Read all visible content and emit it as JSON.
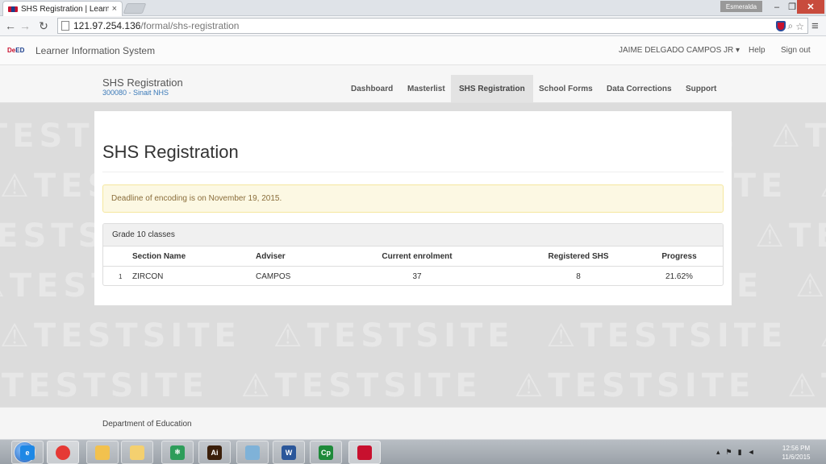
{
  "browser": {
    "tab_title": "SHS Registration | Learner",
    "tab_close": "×",
    "user_badge": "Esmeralda",
    "url_host": "121.97.254.136",
    "url_path": "/formal/shs-registration"
  },
  "header": {
    "logo_a": "De",
    "logo_b": "ED",
    "app_title": "Learner Information System",
    "user_name": "JAIME DELGADO CAMPOS JR",
    "help": "Help",
    "sign_out": "Sign out"
  },
  "subnav": {
    "page_title": "SHS Registration",
    "school": "300080 - Sinait NHS",
    "items": [
      {
        "label": "Dashboard"
      },
      {
        "label": "Masterlist"
      },
      {
        "label": "SHS Registration",
        "active": true
      },
      {
        "label": "School Forms"
      },
      {
        "label": "Data Corrections"
      },
      {
        "label": "Support"
      }
    ]
  },
  "watermark": "⚠TESTSITE",
  "main": {
    "title": "SHS Registration",
    "alert": "Deadline of encoding is on November 19, 2015.",
    "panel_title": "Grade 10 classes",
    "columns": [
      "Section Name",
      "Adviser",
      "Current enrolment",
      "Registered SHS",
      "Progress"
    ],
    "rows": [
      {
        "num": "1",
        "section": "ZIRCON",
        "adviser": "CAMPOS",
        "enrolment": "37",
        "registered": "8",
        "progress": "21.62%"
      }
    ]
  },
  "footer": {
    "text": "Department of Education"
  },
  "taskbar": {
    "items": [
      {
        "name": "ie",
        "glyph": "e",
        "color": "#1e88e5"
      },
      {
        "name": "chrome",
        "glyph": "",
        "color": "#e53935"
      },
      {
        "name": "folder",
        "glyph": "",
        "color": "#f2c14e"
      },
      {
        "name": "explorer",
        "glyph": "",
        "color": "#f4d06f"
      },
      {
        "name": "atom",
        "glyph": "⚛",
        "color": "#2e9d5a"
      },
      {
        "name": "illustrator",
        "glyph": "Ai",
        "color": "#3b1f0a"
      },
      {
        "name": "app",
        "glyph": "",
        "color": "#7fb2d8"
      },
      {
        "name": "word",
        "glyph": "W",
        "color": "#2b579a"
      },
      {
        "name": "cp",
        "glyph": "Cp",
        "color": "#1e8a3a"
      },
      {
        "name": "shield",
        "glyph": "",
        "color": "#c8102e"
      }
    ],
    "time": "12:56 PM",
    "date": "11/6/2015"
  }
}
